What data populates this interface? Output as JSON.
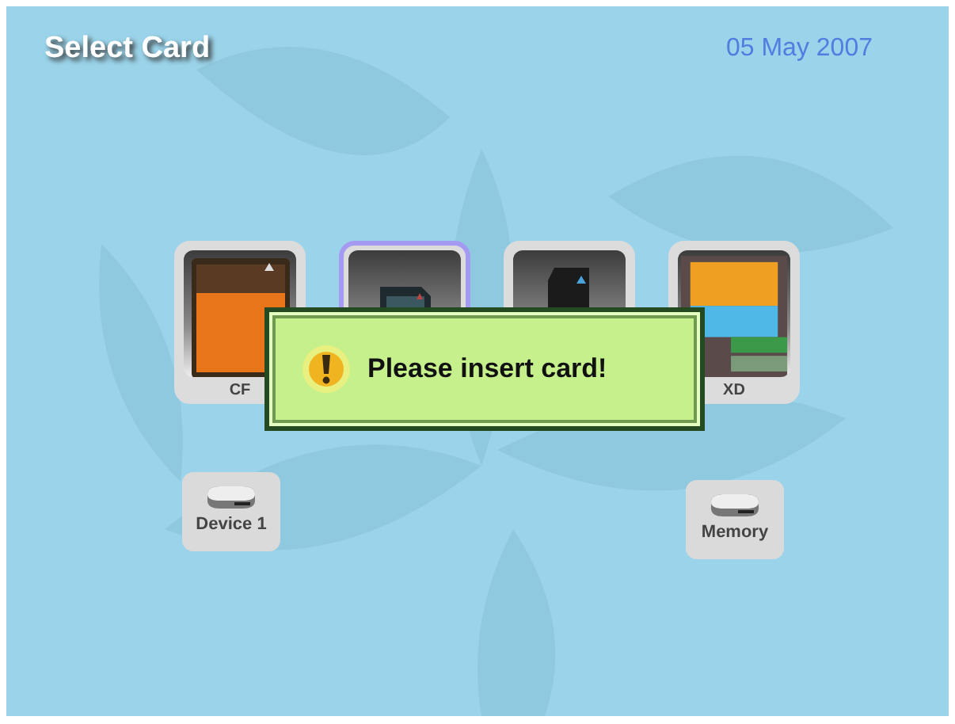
{
  "title": "Select Card",
  "date": "05 May 2007",
  "cards": [
    {
      "kind": "cf",
      "label": "CF",
      "selected": false
    },
    {
      "kind": "sd",
      "selected": true
    },
    {
      "kind": "ms",
      "selected": false
    },
    {
      "kind": "xd",
      "label": "XD",
      "selected": false
    }
  ],
  "devices": [
    {
      "label": "Device 1"
    },
    {
      "label": "Memory"
    }
  ],
  "alert": {
    "message": "Please insert card!"
  }
}
